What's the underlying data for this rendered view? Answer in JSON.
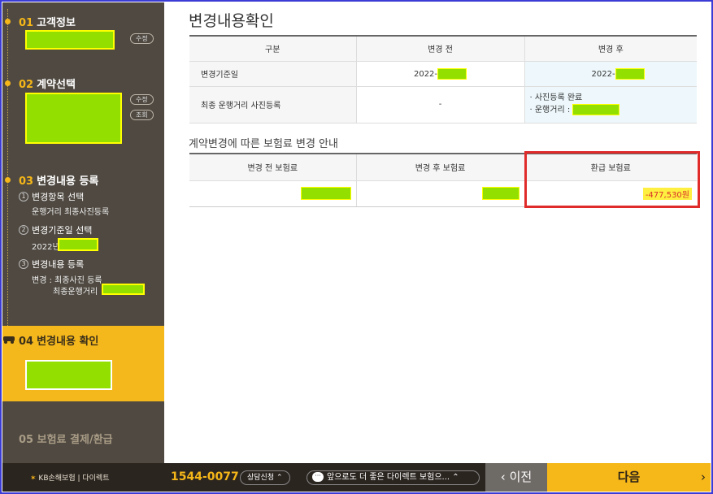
{
  "sidebar": {
    "steps": [
      {
        "num": "01",
        "label": "고객정보",
        "buttons": [
          "수정"
        ]
      },
      {
        "num": "02",
        "label": "계약선택",
        "buttons": [
          "수정",
          "조회"
        ]
      },
      {
        "num": "03",
        "label": "변경내용 등록",
        "sub": [
          {
            "n": "1",
            "label": "변경항목 선택",
            "detail": "운행거리 최종사진등록"
          },
          {
            "n": "2",
            "label": "변경기준일 선택",
            "detail": "2022년"
          },
          {
            "n": "3",
            "label": "변경내용 등록",
            "detail1": "변경 : 최종사진 등록",
            "detail2": "최종운행거리"
          }
        ]
      },
      {
        "num": "04",
        "label": "변경내용 확인"
      },
      {
        "num": "05",
        "label": "보험료 결제/환급"
      }
    ]
  },
  "main": {
    "title": "변경내용확인",
    "table1": {
      "headers": [
        "구분",
        "변경 전",
        "변경 후"
      ],
      "rows": [
        {
          "label": "변경기준일",
          "before": "2022-",
          "after": "2022-"
        },
        {
          "label": "최종 운행거리 사진등록",
          "before": "-",
          "after_items": [
            "· 사진등록 완료",
            "· 운행거리 :"
          ]
        }
      ]
    },
    "section2_title": "계약변경에 따른 보험료 변경 안내",
    "table2": {
      "headers": [
        "변경 전 보험료",
        "변경 후 보험료",
        "환급 보험료"
      ],
      "refund": "-477,530원"
    }
  },
  "bottombar": {
    "logo_text": "KB손해보험 | 다이렉트",
    "phone": "1544-0077",
    "consult": "상담신청",
    "chat": "앞으로도 더 좋은 다이렉트 보험으...",
    "prev": "이전",
    "next": "다음"
  },
  "colors": {
    "accent": "#f6b718",
    "sidebar": "#4f4941",
    "highlight": "#e02b2b"
  }
}
